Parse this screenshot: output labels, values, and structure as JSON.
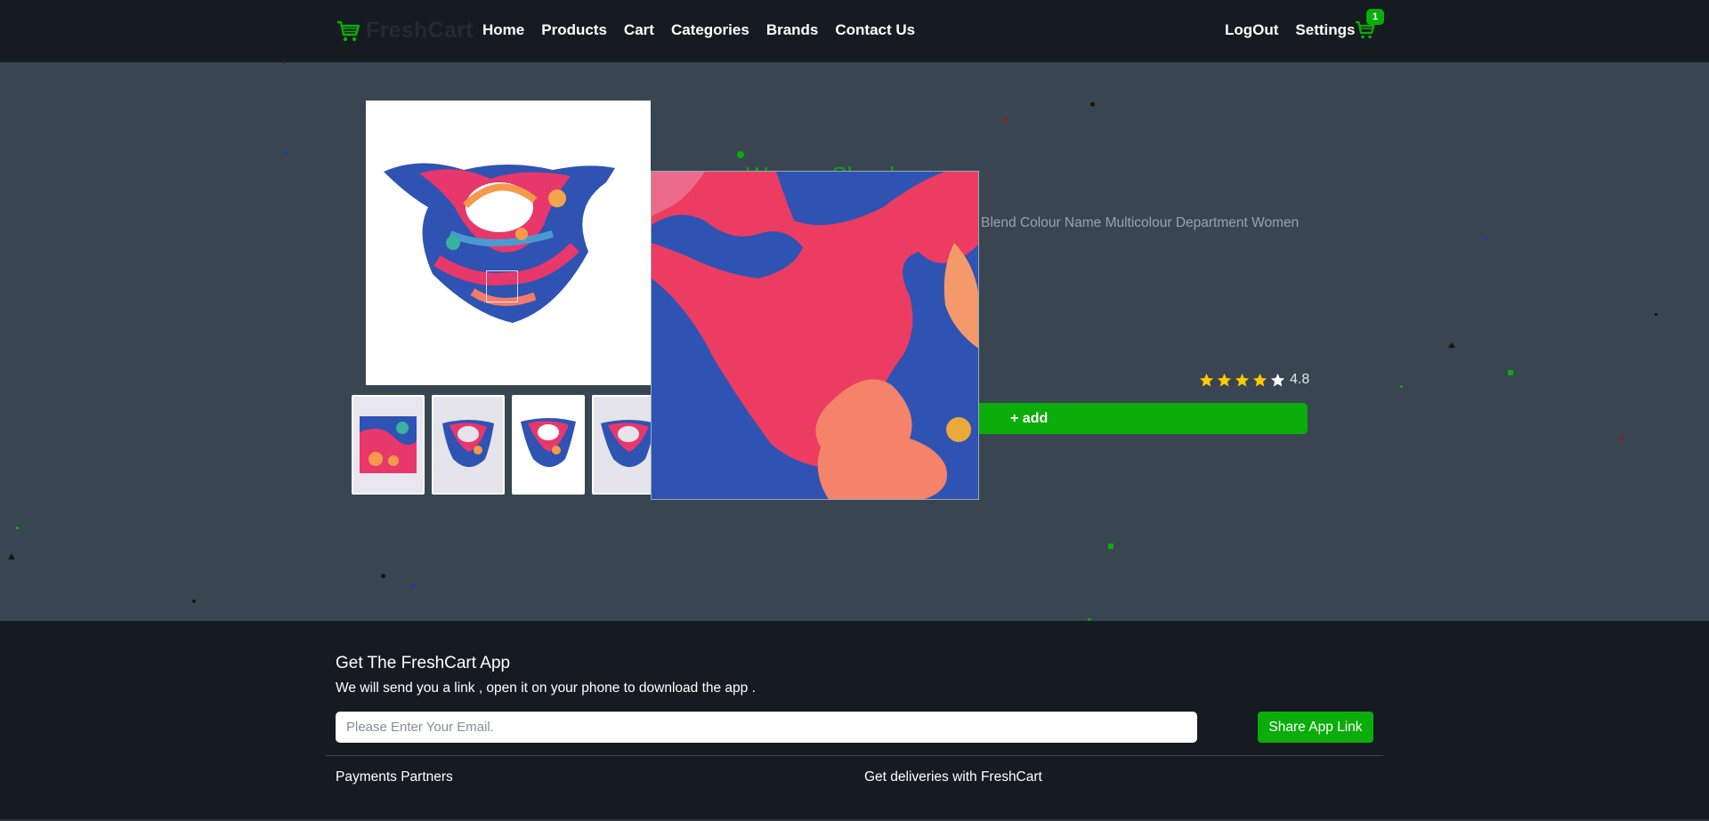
{
  "brand": {
    "name": "FreshCart",
    "accent_color": "#0aad0a"
  },
  "nav": {
    "links": [
      {
        "label": "Home"
      },
      {
        "label": "Products"
      },
      {
        "label": "Cart"
      },
      {
        "label": "Categories"
      },
      {
        "label": "Brands"
      },
      {
        "label": "Contact Us"
      }
    ],
    "right": {
      "logout_label": "LogOut",
      "settings_label": "Settings"
    },
    "cart_count": "1"
  },
  "product": {
    "title": "Women Shawl",
    "description": "Blend Colour Name Multicolour Department Women",
    "rating": "4.8",
    "stars_filled": 4,
    "stars_total": 5,
    "add_label": "+ add"
  },
  "footer": {
    "title": "Get The FreshCart App",
    "subtitle": "We will send you a link , open it on your phone to download the app .",
    "email_placeholder": "Please Enter Your Email.",
    "share_label": "Share App Link",
    "payments_label": "Payments Partners",
    "deliveries_label": "Get deliveries with FreshCart"
  }
}
